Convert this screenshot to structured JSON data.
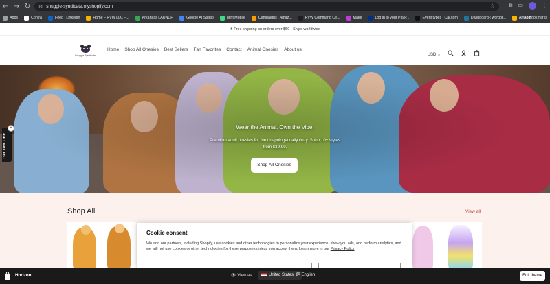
{
  "browser": {
    "url": "snuggle-syndicate.myshopify.com",
    "bookmarks": [
      {
        "label": "Apps",
        "color": "#9aa0a6"
      },
      {
        "label": "Contra",
        "color": "#ffffff"
      },
      {
        "label": "Feed | LinkedIn",
        "color": "#0a66c2"
      },
      {
        "label": "Home – RVW LLC –...",
        "color": "#f4b400"
      },
      {
        "label": "Arkansas LAUNCH",
        "color": "#34a853"
      },
      {
        "label": "Google AI Studio",
        "color": "#4285f4"
      },
      {
        "label": "Mint Mobile",
        "color": "#3ddc84"
      },
      {
        "label": "Campaigns | Amaz...",
        "color": "#ff9900"
      },
      {
        "label": "RVW Command Ce...",
        "color": "#1e1e1e"
      },
      {
        "label": "Make",
        "color": "#c13bdb"
      },
      {
        "label": "Log in to your PayP...",
        "color": "#003087"
      },
      {
        "label": "Event types | Cal.com",
        "color": "#111111"
      },
      {
        "label": "Dashboard ‹ wordpr...",
        "color": "#21759b"
      },
      {
        "label": "Airtable",
        "color": "#fcb400"
      }
    ],
    "all_bookmarks": "All Bookmarks"
  },
  "announcement": "✈ Free shipping on orders over $50 · Ships worldwide",
  "header": {
    "logo_text": "Snuggle Syndicate",
    "nav": [
      "Home",
      "Shop All Onesies",
      "Best Sellers",
      "Fan Favorites",
      "Contact",
      "Animal Onesies",
      "About us"
    ],
    "currency": "USD"
  },
  "hero": {
    "heading": "Wear the Animal. Own the Vibe.",
    "subtext": "Premium adult onesies for the unapologetically cozy. Shop 10+ styles from $39.99.",
    "button": "Shop All Onesies"
  },
  "promo_tab": "Get 10% OFF",
  "shop_all": {
    "title": "Shop All",
    "view_all": "View all"
  },
  "cookie": {
    "title": "Cookie consent",
    "body": "We and our partners, including Shopify, use cookies and other technologies to personalize your experience, show you ads, and perform analytics, and we will not use cookies or other technologies for these purposes unless you accept them. Learn more in our",
    "link": "Privacy Policy"
  },
  "bottom_bar": {
    "store": "Horizon",
    "view_as": "View as",
    "country": "United States",
    "language": "English",
    "edit": "Edit theme"
  },
  "colors": {
    "accent": "#b84848",
    "shop_bg": "#fdf1ee",
    "chrome": "#35363a",
    "bottom_bar": "#1a1a1a"
  }
}
